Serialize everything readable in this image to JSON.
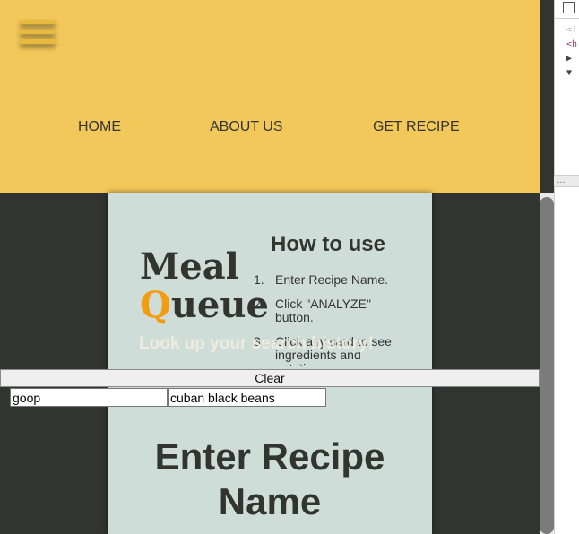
{
  "nav": {
    "home": "HOME",
    "about": "ABOUT US",
    "get_recipe": "GET RECIPE"
  },
  "logo": {
    "line1": "Meal",
    "q_letter": "Q",
    "line2_rest": "ueue"
  },
  "how_to": {
    "title": "How to use",
    "steps": [
      {
        "num": "1.",
        "text": "Enter Recipe Name."
      },
      {
        "num": "2.",
        "text": "Click \"ANALYZE\" button."
      },
      {
        "num": "3.",
        "text": "Click any card to see ingredients and nutrition."
      }
    ]
  },
  "search_history": {
    "heading": "Look up your search history!",
    "clear_label": "Clear",
    "items": [
      "goop",
      "cuban black beans"
    ]
  },
  "main": {
    "enter_title": "Enter Recipe Name"
  },
  "devtools": {
    "lines": [
      "<!",
      "<h",
      "▶",
      "▼"
    ],
    "split": "…"
  },
  "colors": {
    "header_bg": "#f3c85a",
    "page_bg": "#323432",
    "panel_bg": "#cfddd8",
    "accent": "#f39c12"
  }
}
